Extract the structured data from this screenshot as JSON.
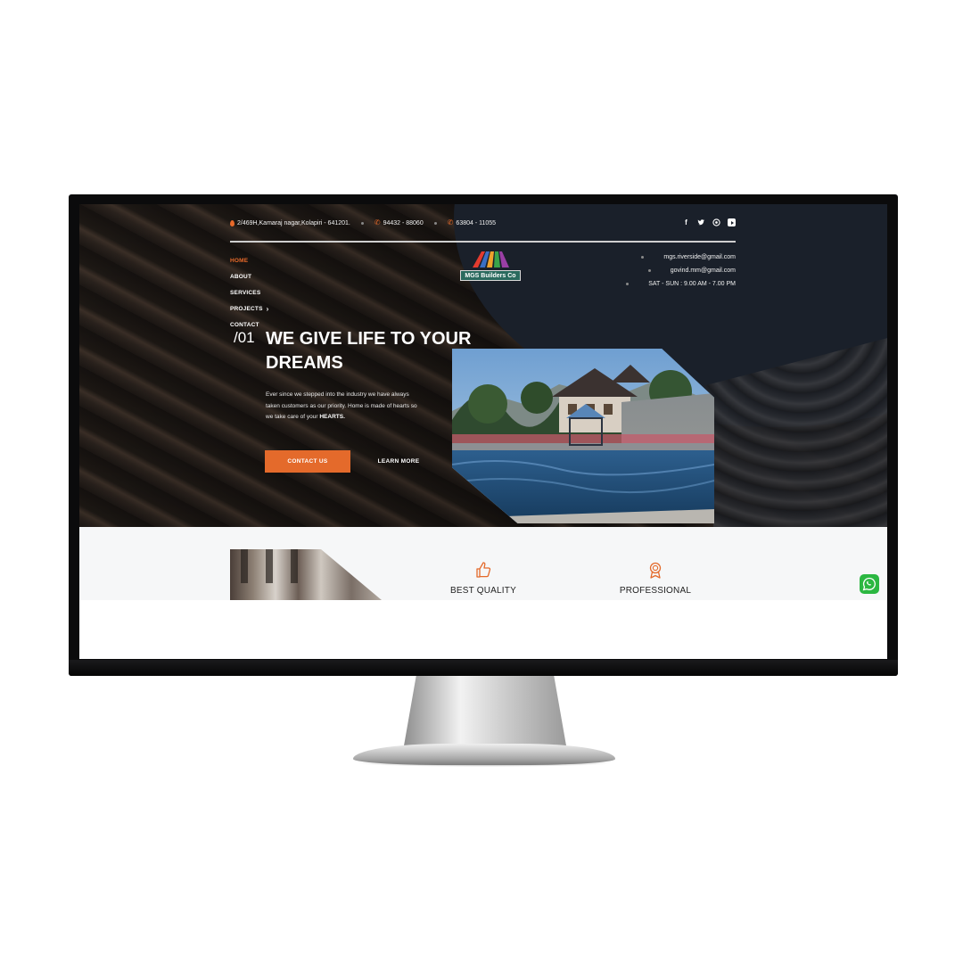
{
  "topbar": {
    "address": "2/469H,Kamaraj nagar,Kolapiri - 641201.",
    "phone_1": "94432 - 88060",
    "phone_2": "63804 - 11055"
  },
  "social": [
    "facebook-icon",
    "twitter-icon",
    "instagram-icon",
    "youtube-icon"
  ],
  "nav": {
    "items": [
      {
        "label": "HOME",
        "active": true
      },
      {
        "label": "ABOUT"
      },
      {
        "label": "SERVICES"
      },
      {
        "label": "PROJECTS",
        "has_submenu": true
      },
      {
        "label": "CONTACT"
      }
    ]
  },
  "logo": {
    "text": "MGS Builders Co"
  },
  "contact": {
    "email_1": "mgs.riverside@gmail.com",
    "email_2": "govind.mm@gmail.com",
    "hours": "SAT - SUN : 9.00 AM - 7.00 PM"
  },
  "hero": {
    "slide_number": "/01",
    "headline_line1": "WE GIVE LIFE TO YOUR",
    "headline_line2": "DREAMS",
    "body": "Ever since we stepped into the industry we have always taken customers as our priority.   Home is made of hearts so we take care of your ",
    "body_emphasis": "HEARTS.",
    "cta_primary": "CONTACT US",
    "cta_secondary": "LEARN MORE"
  },
  "features": [
    {
      "label": "BEST QUALITY",
      "icon": "thumbs-up-icon"
    },
    {
      "label": "PROFESSIONAL",
      "icon": "award-icon"
    }
  ],
  "colors": {
    "accent": "#e46a2b",
    "logo_green": "#2a6a5e",
    "whatsapp": "#2bb741"
  }
}
